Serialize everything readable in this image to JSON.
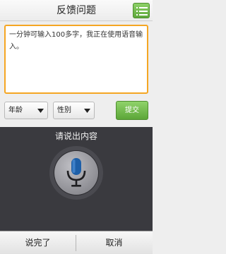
{
  "header": {
    "title": "反馈问题",
    "menu_icon": "list-menu-icon"
  },
  "feedback": {
    "text": "一分钟可输入100多字，我正在使用语音输入。"
  },
  "form": {
    "age_label": "年龄",
    "gender_label": "性别",
    "submit_label": "提交"
  },
  "voice": {
    "prompt": "请说出内容",
    "mic_icon": "microphone-icon",
    "done_label": "说完了",
    "cancel_label": "取消"
  },
  "colors": {
    "accent_green": "#5fa83b",
    "textarea_border": "#f5a623",
    "voice_panel_bg": "#3a3a3f"
  }
}
